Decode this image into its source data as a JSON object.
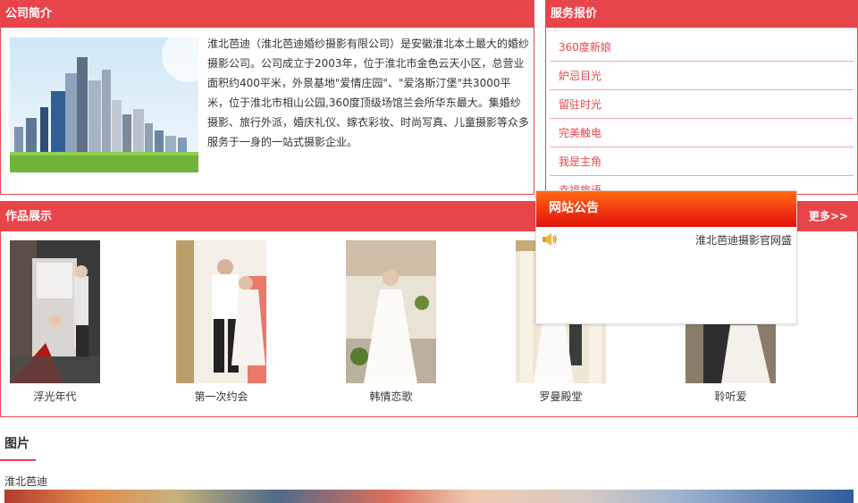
{
  "intro": {
    "title": "公司简介",
    "text": "淮北芭迪（淮北芭迪婚纱摄影有限公司）是安徽淮北本土最大的婚纱摄影公司。公司成立于2003年，位于淮北市金色云天小区，总营业面积约400平米，外景基地\"爱情庄园\"、\"爱洛斯汀堡\"共3000平米，位于淮北市相山公园,360度顶级场馆兰会所华东最大。集婚纱摄影、旅行外派，婚庆礼仪、嫁衣彩妆、时尚写真、儿童摄影等众多服务于一身的一站式摄影企业。"
  },
  "service": {
    "title": "服务报价",
    "items": [
      "360度新娘",
      "妒忌目光",
      "留驻时光",
      "完美触电",
      "我是主角",
      "幸福旅语"
    ]
  },
  "works": {
    "title": "作品展示",
    "more": "更多>>",
    "items": [
      "浮光年代",
      "第一次约会",
      "韩情恋歌",
      "罗曼殿堂",
      "聆听爱"
    ]
  },
  "notice": {
    "title": "网站公告",
    "text": "淮北芭迪摄影官网盛"
  },
  "images": {
    "title": "图片",
    "caption": "淮北芭迪"
  },
  "colors": {
    "accent": "#e8454b",
    "notice_header": "#f43a10"
  }
}
